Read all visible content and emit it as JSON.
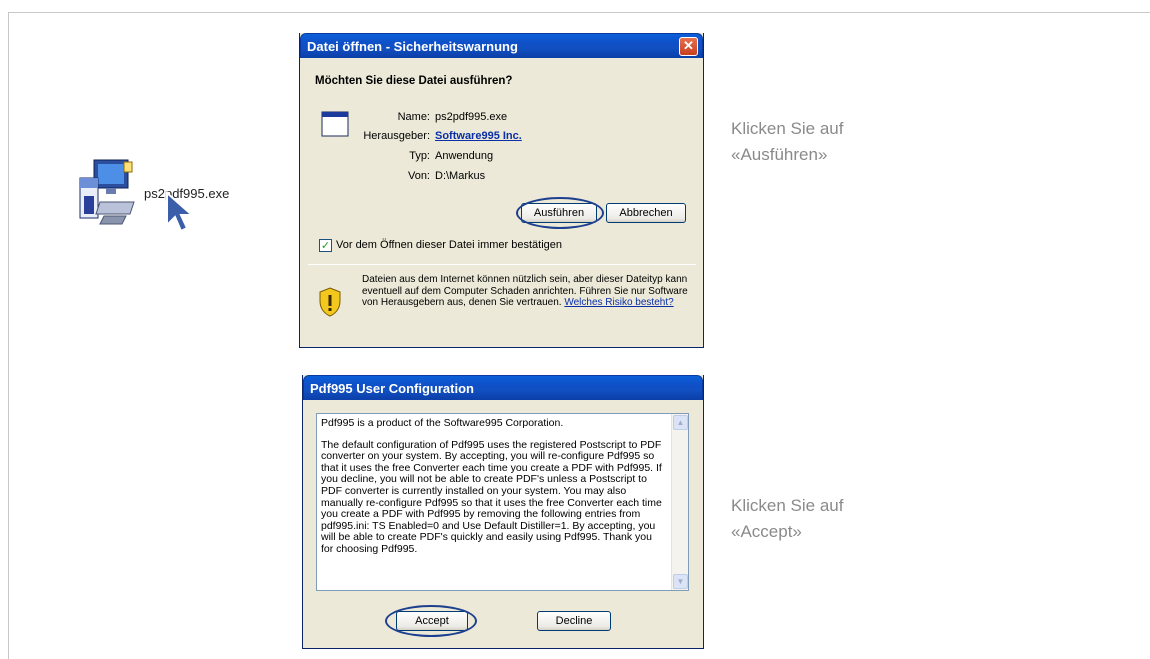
{
  "desktop": {
    "file_name": "ps2pdf995.exe"
  },
  "security_dialog": {
    "title": "Datei öffnen - Sicherheitswarnung",
    "close_glyph": "✕",
    "question": "Möchten Sie diese Datei ausführen?",
    "fields": [
      {
        "label": "Name:",
        "value": "ps2pdf995.exe"
      },
      {
        "label": "Herausgeber:",
        "value": "Software995 Inc."
      },
      {
        "label": "Typ:",
        "value": "Anwendung"
      },
      {
        "label": "Von:",
        "value": "D:\\Markus"
      }
    ],
    "run_button": "Ausführen",
    "cancel_button": "Abbrechen",
    "checkbox_label": "Vor dem Öffnen dieser Datei immer bestätigen",
    "checkbox_checked": true,
    "warning_text": "Dateien aus dem Internet können nützlich sein, aber dieser Dateityp kann eventuell auf dem Computer Schaden anrichten. Führen Sie nur Software von Herausgebern aus, denen Sie vertrauen.",
    "warning_link": "Welches Risiko besteht?"
  },
  "caption_run": [
    "Klicken Sie auf",
    "«Ausführen»"
  ],
  "config_dialog": {
    "title": "Pdf995 User Configuration",
    "paragraph1": "Pdf995 is a product of the Software995 Corporation.",
    "paragraph2": "The default configuration of Pdf995 uses the registered Postscript to PDF converter on your system. By accepting, you will re-configure Pdf995 so that it uses the free Converter each time you create a PDF with Pdf995. If you decline, you will not be able to create PDF's unless a Postscript to PDF converter is currently installed on your system. You may also manually re-configure Pdf995 so that it uses the free Converter each time you create a PDF with Pdf995 by removing the following entries from pdf995.ini: TS Enabled=0 and Use Default Distiller=1. By accepting, you will be able to create PDF's quickly and easily using Pdf995. Thank you for choosing Pdf995.",
    "accept_button": "Accept",
    "decline_button": "Decline"
  },
  "caption_accept": [
    "Klicken Sie auf",
    "«Accept»"
  ],
  "colors": {
    "title_blue": "#0f4fc7",
    "dialog_bg": "#ece9d8",
    "caption_gray": "#8a8a8a",
    "ring_blue": "#1c3f8f"
  }
}
